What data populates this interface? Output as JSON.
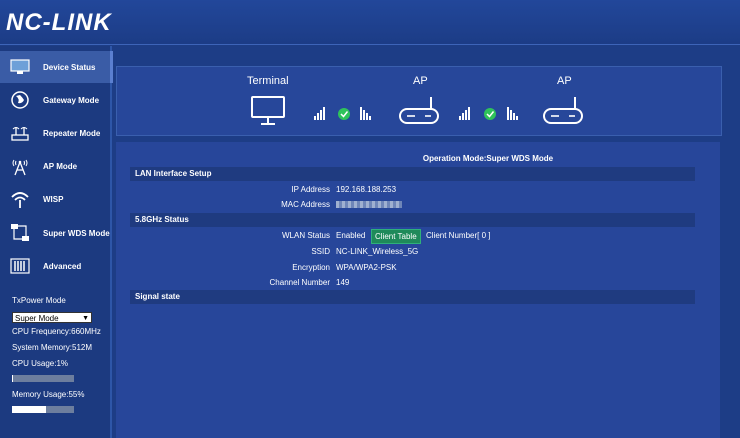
{
  "logo": "NC-LINK",
  "nav": [
    {
      "label": "Device Status",
      "icon": "monitor-icon"
    },
    {
      "label": "Gateway Mode",
      "icon": "globe-icon"
    },
    {
      "label": "Repeater Mode",
      "icon": "repeater-icon"
    },
    {
      "label": "AP Mode",
      "icon": "antenna-icon"
    },
    {
      "label": "WISP",
      "icon": "wifi-icon"
    },
    {
      "label": "Super WDS Mode",
      "icon": "wds-icon"
    },
    {
      "label": "Advanced",
      "icon": "equalizer-icon"
    }
  ],
  "stats": {
    "txpower_label": "TxPower Mode",
    "txpower_value": "Super Mode",
    "cpu_freq": "CPU Frequency:660MHz",
    "sys_mem": "System Memory:512M",
    "cpu_usage": "CPU Usage:1%",
    "cpu_usage_value": 1,
    "mem_usage": "Memory Usage:55%",
    "mem_usage_value": 55
  },
  "topology": {
    "terminal_label": "Terminal",
    "ap1_label": "AP",
    "ap2_label": "AP"
  },
  "content": {
    "mode_title": "Operation Mode:Super WDS Mode",
    "lan_section": "LAN Interface Setup",
    "ip_label": "IP Address",
    "ip_value": "192.168.188.253",
    "mac_label": "MAC Address",
    "wifi_section": "5.8GHz Status",
    "wlan_label": "WLAN Status",
    "wlan_value": "Enabled",
    "client_table_btn": "Client Table",
    "client_number": "Client Number[ 0 ]",
    "ssid_label": "SSID",
    "ssid_value": "NC-LINK_Wireless_5G",
    "enc_label": "Encryption",
    "enc_value": "WPA/WPA2-PSK",
    "channel_label": "Channel Number",
    "channel_value": "149",
    "signal_section": "Signal state"
  },
  "colors": {
    "background": "#1d3d86",
    "accent_green": "#2fc35a",
    "button_green": "#1f8a5a"
  }
}
